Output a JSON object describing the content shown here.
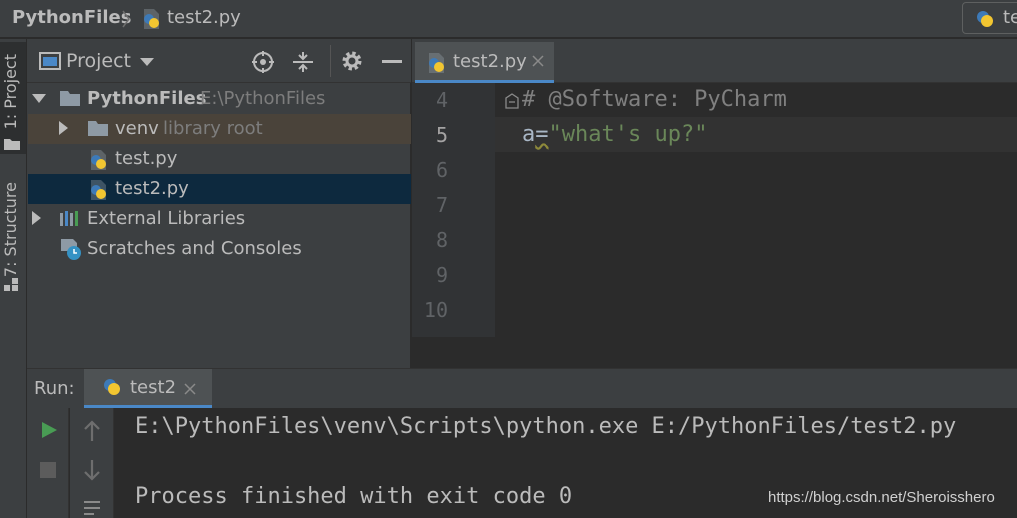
{
  "navbar": {
    "project": "PythonFiles",
    "file": "test2.py",
    "run_config": "te"
  },
  "left_strip": {
    "project_tab": "1: Project",
    "structure_tab": "7: Structure"
  },
  "project_panel": {
    "title": "Project",
    "tree": [
      {
        "name": "PythonFiles",
        "hint": "E:\\PythonFiles"
      },
      {
        "name": "venv",
        "hint": "library root"
      },
      {
        "name": "test.py"
      },
      {
        "name": "test2.py"
      },
      {
        "name": "External Libraries"
      },
      {
        "name": "Scratches and Consoles"
      }
    ]
  },
  "editor": {
    "tab": "test2.py",
    "line_numbers": [
      "4",
      "5",
      "6",
      "7",
      "8",
      "9",
      "10"
    ],
    "comment": "# @Software: PyCharm",
    "code_var": "a",
    "code_op": "=",
    "code_str": "\"what's up?\""
  },
  "run": {
    "label": "Run:",
    "tab": "test2",
    "command": "E:\\PythonFiles\\venv\\Scripts\\python.exe E:/PythonFiles/test2.py",
    "exit": "Process finished with exit code 0"
  },
  "watermark": "https://blog.csdn.net/Sheroisshero",
  "colors": {
    "accent": "#4a88c7",
    "selection": "#0d293e",
    "run_green": "#499c54",
    "string": "#6a8759",
    "comment": "#808080"
  }
}
